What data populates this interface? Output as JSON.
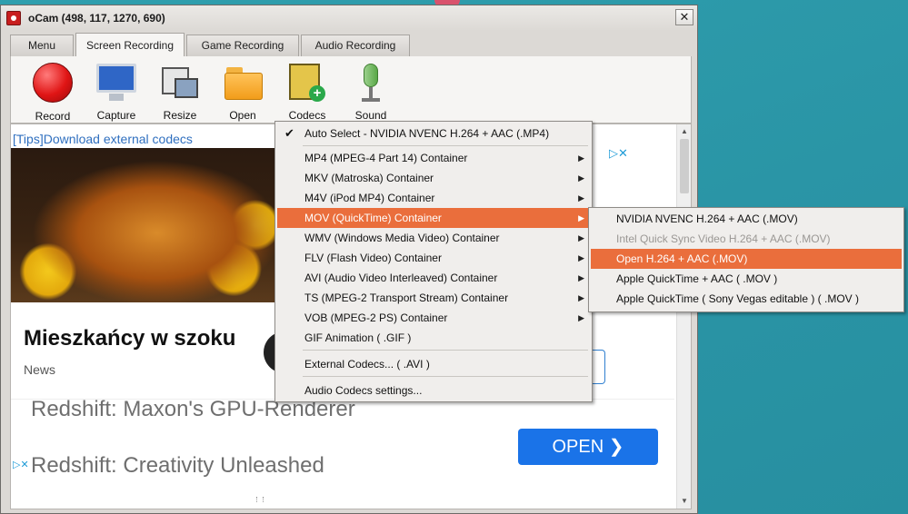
{
  "window": {
    "title": "oCam (498, 117, 1270, 690)",
    "close_glyph": "✕"
  },
  "tabs": [
    {
      "label": "Menu"
    },
    {
      "label": "Screen Recording",
      "active": true
    },
    {
      "label": "Game Recording"
    },
    {
      "label": "Audio Recording"
    }
  ],
  "toolbar": {
    "record": {
      "label": "Record",
      "icon": "record-icon"
    },
    "capture": {
      "label": "Capture",
      "icon": "monitor-icon"
    },
    "resize": {
      "label": "Resize",
      "icon": "resize-icon"
    },
    "open": {
      "label": "Open",
      "icon": "folder-icon"
    },
    "codecs": {
      "label": "Codecs",
      "icon": "film-add-icon"
    },
    "sound": {
      "label": "Sound",
      "icon": "microphone-icon"
    }
  },
  "content": {
    "tips_link": "[Tips]Download external codecs",
    "ad_title": "Mieszkańcy w szoku",
    "ad_source": "News",
    "redshift_line1": "Redshift: Maxon's GPU-Renderer",
    "redshift_line2": "Redshift: Creativity Unleashed",
    "open_button": "OPEN  ❯",
    "adchoices_glyph": "▷✕"
  },
  "codecs_menu": {
    "items": [
      {
        "label": "Auto Select - NVIDIA NVENC H.264 + AAC (.MP4)",
        "checked": true,
        "submenu": false
      },
      {
        "label": "MP4 (MPEG-4 Part 14) Container",
        "submenu": true
      },
      {
        "label": "MKV (Matroska) Container",
        "submenu": true
      },
      {
        "label": "M4V (iPod MP4) Container",
        "submenu": true
      },
      {
        "label": "MOV (QuickTime) Container",
        "submenu": true,
        "highlighted": true
      },
      {
        "label": "WMV (Windows Media Video) Container",
        "submenu": true
      },
      {
        "label": "FLV (Flash Video) Container",
        "submenu": true
      },
      {
        "label": "AVI (Audio Video Interleaved) Container",
        "submenu": true
      },
      {
        "label": "TS (MPEG-2 Transport Stream) Container",
        "submenu": true
      },
      {
        "label": "VOB (MPEG-2 PS) Container",
        "submenu": true
      },
      {
        "label": "GIF Animation ( .GIF )",
        "submenu": false
      },
      {
        "label": "External Codecs... ( .AVI )",
        "submenu": false
      },
      {
        "label": "Audio Codecs settings...",
        "submenu": false
      }
    ],
    "check_glyph": "✔",
    "arrow_glyph": "▶"
  },
  "mov_submenu": {
    "items": [
      {
        "label": "NVIDIA NVENC H.264 + AAC (.MOV)"
      },
      {
        "label": "Intel Quick Sync Video H.264 + AAC (.MOV)",
        "disabled": true
      },
      {
        "label": "Open H.264 + AAC (.MOV)",
        "highlighted": true
      },
      {
        "label": "Apple QuickTime + AAC ( .MOV )"
      },
      {
        "label": "Apple QuickTime ( Sony Vegas editable ) ( .MOV )"
      }
    ]
  },
  "colors": {
    "menu_highlight": "#ea6e3c",
    "open_button": "#1a73e8",
    "link": "#2f6fbf",
    "desktop": "#2f9fae"
  }
}
